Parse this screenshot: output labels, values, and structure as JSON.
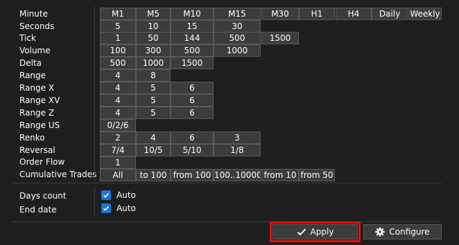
{
  "rows": [
    {
      "label": "Minute",
      "buttons": [
        "M1",
        "M5",
        "M10",
        "M15",
        "M30",
        "H1",
        "H4",
        "Daily",
        "Weekly"
      ]
    },
    {
      "label": "Seconds",
      "buttons": [
        "5",
        "10",
        "15",
        "30"
      ]
    },
    {
      "label": "Tick",
      "buttons": [
        "1",
        "50",
        "144",
        "500",
        "1500"
      ]
    },
    {
      "label": "Volume",
      "buttons": [
        "100",
        "300",
        "500",
        "1000"
      ]
    },
    {
      "label": "Delta",
      "buttons": [
        "500",
        "1000",
        "1500"
      ]
    },
    {
      "label": "Range",
      "buttons": [
        "4",
        "8"
      ]
    },
    {
      "label": "Range X",
      "buttons": [
        "4",
        "5",
        "6"
      ]
    },
    {
      "label": "Range XV",
      "buttons": [
        "4",
        "5",
        "6"
      ]
    },
    {
      "label": "Range Z",
      "buttons": [
        "4",
        "5",
        "6"
      ]
    },
    {
      "label": "Range US",
      "buttons": [
        "0/2/6"
      ]
    },
    {
      "label": "Renko",
      "buttons": [
        "2",
        "4",
        "6",
        "3"
      ]
    },
    {
      "label": "Reversal",
      "buttons": [
        "7/4",
        "10/5",
        "5/10",
        "1/8"
      ]
    },
    {
      "label": "Order Flow",
      "buttons": [
        "1"
      ]
    },
    {
      "label": "Cumulative Trades",
      "buttons": [
        "All",
        "to 100",
        "from 100",
        "100..10000",
        "from 10",
        "from 50"
      ]
    }
  ],
  "options": {
    "days_count": {
      "label": "Days count",
      "checked": true,
      "checkbox_label": "Auto"
    },
    "end_date": {
      "label": "End date",
      "checked": true,
      "checkbox_label": "Auto"
    }
  },
  "actions": {
    "apply_label": "Apply",
    "configure_label": "Configure"
  },
  "colors": {
    "background": "#1e1e1e",
    "button": "#3c3c3c",
    "checkbox": "#1976d2",
    "highlight": "#e01010"
  }
}
